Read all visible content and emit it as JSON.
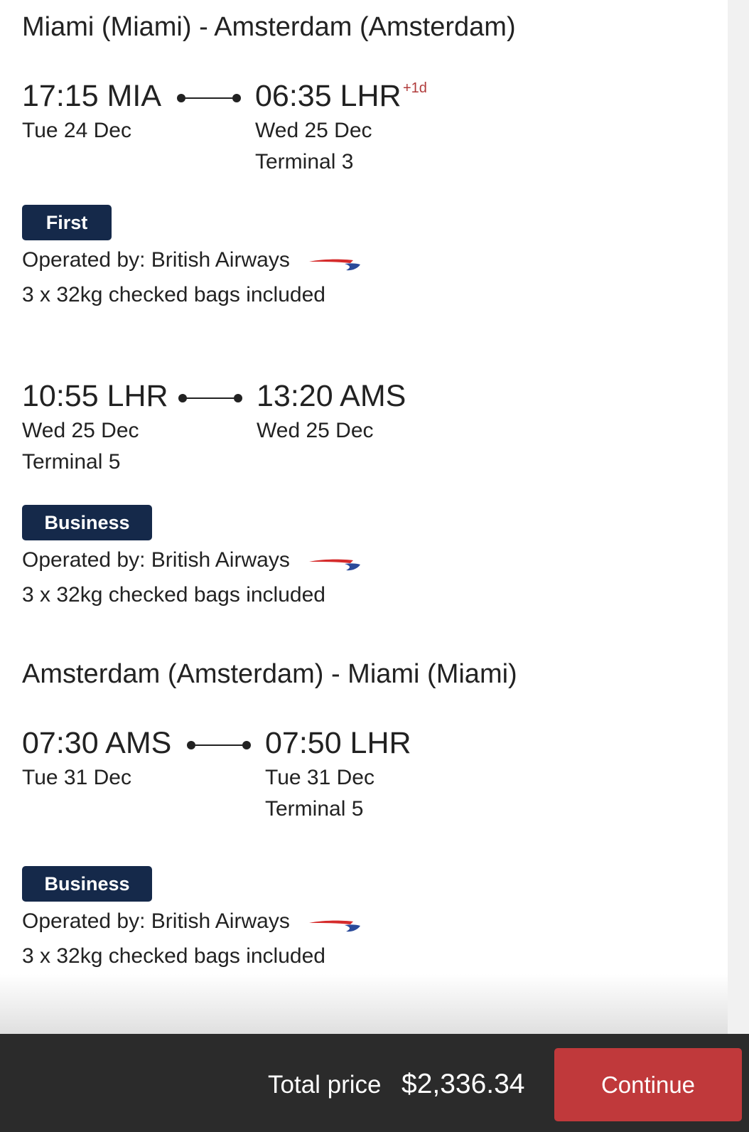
{
  "outbound": {
    "title": "Miami (Miami) - Amsterdam (Amsterdam)",
    "segments": [
      {
        "dep_time": "17:15 MIA",
        "dep_date": "Tue 24 Dec",
        "dep_terminal": "",
        "arr_time": "06:35 LHR",
        "arr_day_offset": "+1d",
        "arr_date": "Wed 25 Dec",
        "arr_terminal": "Terminal 3",
        "cabin": "First",
        "operator": "Operated by: British Airways",
        "operator_logo": "british-airways-logo",
        "bags": "3 x 32kg checked bags included"
      },
      {
        "dep_time": "10:55 LHR",
        "dep_date": "Wed 25 Dec",
        "dep_terminal": "Terminal 5",
        "arr_time": "13:20 AMS",
        "arr_date": "Wed 25 Dec",
        "arr_terminal": "",
        "cabin": "Business",
        "operator": "Operated by: British Airways",
        "operator_logo": "british-airways-logo",
        "bags": "3 x 32kg checked bags included"
      }
    ]
  },
  "inbound": {
    "title": "Amsterdam (Amsterdam) - Miami (Miami)",
    "segments": [
      {
        "dep_time": "07:30 AMS",
        "dep_date": "Tue 31 Dec",
        "dep_terminal": "",
        "arr_time": "07:50 LHR",
        "arr_date": "Tue 31 Dec",
        "arr_terminal": "Terminal 5",
        "cabin": "Business",
        "operator": "Operated by: British Airways",
        "operator_logo": "british-airways-logo",
        "bags": "3 x 32kg checked bags included"
      }
    ]
  },
  "footer": {
    "total_label": "Total price",
    "total_value": "$2,336.34",
    "continue_label": "Continue"
  },
  "colors": {
    "badge_bg": "#15294a",
    "continue_bg": "#c0393b",
    "footer_bg": "#2b2b2b",
    "day_offset": "#b03a3a"
  }
}
